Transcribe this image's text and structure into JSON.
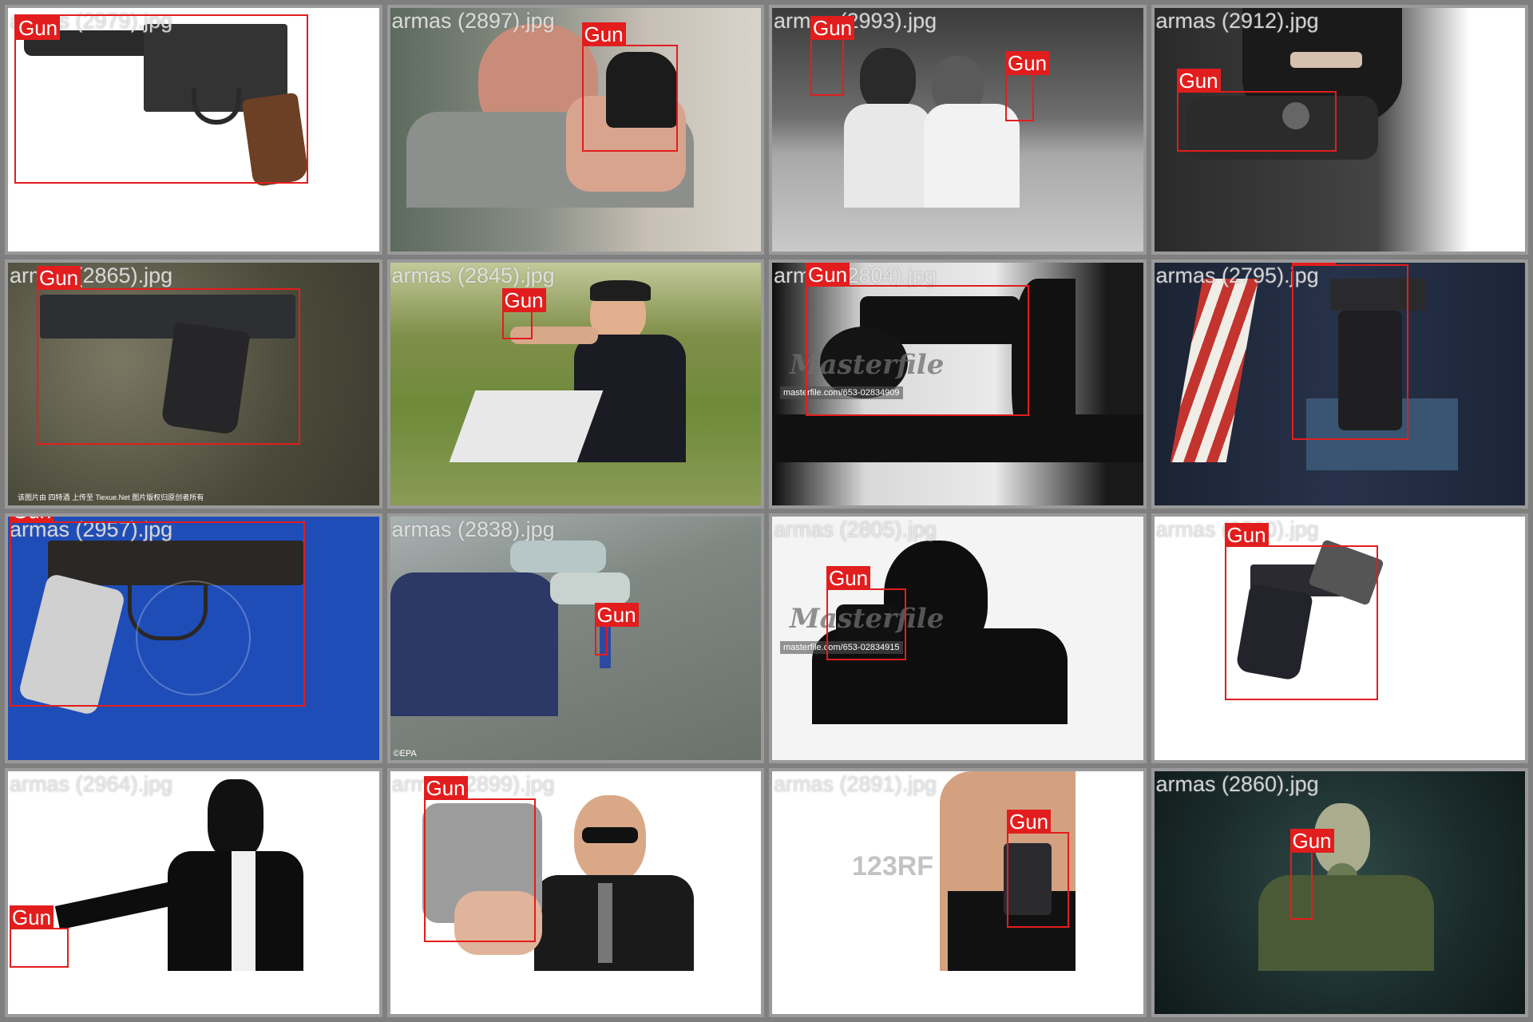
{
  "bbox_label": "Gun",
  "colors": {
    "bbox": "#e21d1d",
    "grid_bg": "#7f7f7f"
  },
  "tiles": [
    {
      "filename": "armas (2979).jpg"
    },
    {
      "filename": "armas (2897).jpg"
    },
    {
      "filename": "armas (2993).jpg"
    },
    {
      "filename": "armas (2912).jpg"
    },
    {
      "filename": "armas (2865).jpg",
      "caption": "该图片由 四特酒 上传至 Tiexue.Net 图片版权归原创者所有"
    },
    {
      "filename": "armas (2845).jpg"
    },
    {
      "filename": "armas (2804).jpg",
      "watermark": "Masterfile",
      "watermark_url": "masterfile.com/653-02834909"
    },
    {
      "filename": "armas (2795).jpg"
    },
    {
      "filename": "armas (2957).jpg"
    },
    {
      "filename": "armas (2838).jpg",
      "caption": "©EPA"
    },
    {
      "filename": "armas (2805).jpg",
      "watermark": "Masterfile",
      "watermark_url": "masterfile.com/653-02834915"
    },
    {
      "filename": "armas (2860).jpg"
    },
    {
      "filename": "armas (2964).jpg"
    },
    {
      "filename": "armas (2899).jpg"
    },
    {
      "filename": "armas (2891).jpg",
      "watermark": "123RF"
    },
    {
      "filename": "armas (2860).jpg"
    }
  ]
}
